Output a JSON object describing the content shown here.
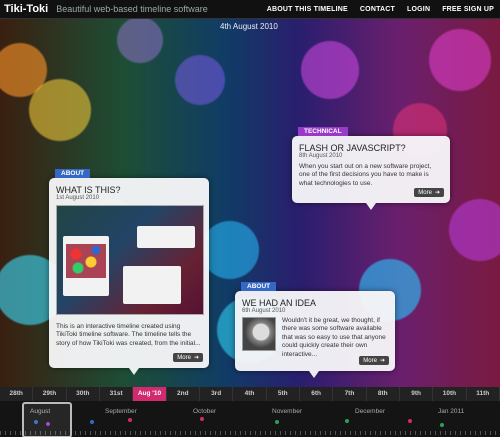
{
  "header": {
    "logo": "Tiki-Toki",
    "tagline": "Beautiful web-based timeline software",
    "nav": [
      "ABOUT THIS TIMELINE",
      "CONTACT",
      "LOGIN",
      "FREE SIGN UP"
    ]
  },
  "current_date": "4th August 2010",
  "cards": {
    "what_is_this": {
      "category": "ABOUT",
      "title": "WHAT IS THIS?",
      "date": "1st August 2010",
      "text": "This is an interactive timeline created using TikiToki timeline software. The timeline tells the story of how TikiToki was created, from the initial...",
      "more": "More"
    },
    "flash_or_js": {
      "category": "TECHNICAL",
      "title": "FLASH OR JAVASCRIPT?",
      "date": "8th August 2010",
      "text": "When you start out on a new software project, one of the first decisions you have to make is what technologies to use.",
      "more": "More"
    },
    "we_had_an_idea": {
      "category": "ABOUT",
      "title": "WE HAD AN IDEA",
      "date": "6th August 2010",
      "text": "Wouldn't it be great, we thought, if there was some software available that was so easy to use that anyone could quickly create their own interactive...",
      "more": "More"
    }
  },
  "datebar": {
    "days": [
      "28th",
      "29th",
      "30th",
      "31st",
      "Aug '10",
      "2nd",
      "3rd",
      "4th",
      "5th",
      "6th",
      "7th",
      "8th",
      "9th",
      "10th",
      "11th"
    ],
    "active_index": 4
  },
  "months": [
    "August",
    "September",
    "October",
    "November",
    "December",
    "Jan 2011"
  ],
  "colors": {
    "about": "#3568c4",
    "technical": "#9a3ac8",
    "active_date": "#d22a6e"
  }
}
